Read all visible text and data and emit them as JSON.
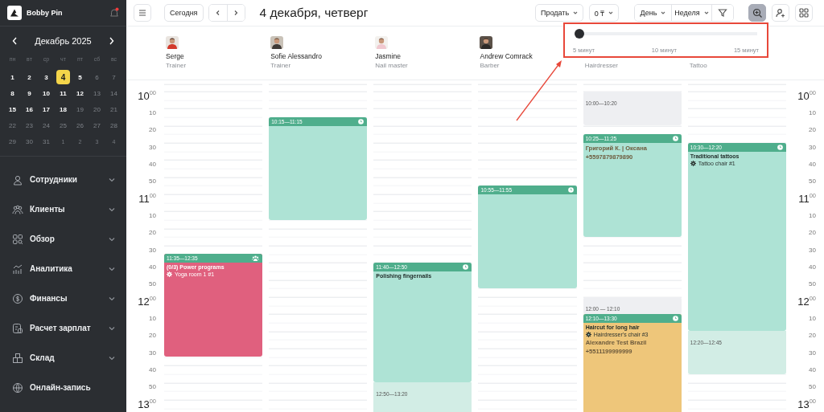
{
  "sidebar": {
    "brand": "Bobby Pin",
    "notification": true,
    "calendar": {
      "month": "Декабрь 2025",
      "weekdays": [
        "пн",
        "вт",
        "ср",
        "чт",
        "пт",
        "сб",
        "вс"
      ],
      "days": [
        {
          "label": "1",
          "kind": "active",
          "selected": false
        },
        {
          "label": "2",
          "kind": "active",
          "selected": false
        },
        {
          "label": "3",
          "kind": "active",
          "selected": false
        },
        {
          "label": "4",
          "kind": "active",
          "selected": true
        },
        {
          "label": "5",
          "kind": "active",
          "selected": false
        },
        {
          "label": "6",
          "kind": "muted",
          "selected": false
        },
        {
          "label": "7",
          "kind": "muted",
          "selected": false
        },
        {
          "label": "8",
          "kind": "active",
          "selected": false
        },
        {
          "label": "9",
          "kind": "active",
          "selected": false
        },
        {
          "label": "10",
          "kind": "active",
          "selected": false
        },
        {
          "label": "11",
          "kind": "active",
          "selected": false
        },
        {
          "label": "12",
          "kind": "active",
          "selected": false
        },
        {
          "label": "13",
          "kind": "muted",
          "selected": false
        },
        {
          "label": "14",
          "kind": "muted",
          "selected": false
        },
        {
          "label": "15",
          "kind": "active",
          "selected": false
        },
        {
          "label": "16",
          "kind": "active",
          "selected": false
        },
        {
          "label": "17",
          "kind": "active",
          "selected": false
        },
        {
          "label": "18",
          "kind": "active",
          "selected": false
        },
        {
          "label": "19",
          "kind": "muted",
          "selected": false
        },
        {
          "label": "20",
          "kind": "muted",
          "selected": false
        },
        {
          "label": "21",
          "kind": "muted",
          "selected": false
        },
        {
          "label": "22",
          "kind": "muted",
          "selected": false
        },
        {
          "label": "23",
          "kind": "muted",
          "selected": false
        },
        {
          "label": "24",
          "kind": "muted",
          "selected": false
        },
        {
          "label": "25",
          "kind": "muted",
          "selected": false
        },
        {
          "label": "26",
          "kind": "muted",
          "selected": false
        },
        {
          "label": "27",
          "kind": "muted",
          "selected": false
        },
        {
          "label": "28",
          "kind": "muted",
          "selected": false
        },
        {
          "label": "29",
          "kind": "muted",
          "selected": false
        },
        {
          "label": "30",
          "kind": "muted",
          "selected": false
        },
        {
          "label": "31",
          "kind": "muted",
          "selected": false
        },
        {
          "label": "1",
          "kind": "outside",
          "selected": false
        },
        {
          "label": "2",
          "kind": "outside",
          "selected": false
        },
        {
          "label": "3",
          "kind": "outside",
          "selected": false
        },
        {
          "label": "4",
          "kind": "outside",
          "selected": false
        }
      ]
    },
    "items": [
      {
        "label": "Сотрудники",
        "expandable": true
      },
      {
        "label": "Клиенты",
        "expandable": true
      },
      {
        "label": "Обзор",
        "expandable": true
      },
      {
        "label": "Аналитика",
        "expandable": true
      },
      {
        "label": "Финансы",
        "expandable": true
      },
      {
        "label": "Расчет зарплат",
        "expandable": true
      },
      {
        "label": "Склад",
        "expandable": true
      },
      {
        "label": "Онлайн-запись",
        "expandable": false
      }
    ]
  },
  "toolbar": {
    "today": "Сегодня",
    "title": "4 декабря, четверг",
    "sell_menu": "Продать",
    "currency_menu": "0 ₸",
    "view_menus": [
      "День",
      "Неделя"
    ],
    "tool_buttons": [
      {
        "selected": true
      },
      {
        "selected": false
      },
      {
        "selected": false
      }
    ]
  },
  "zoom_popover": {
    "level": 0,
    "labels": [
      "5 минут",
      "10 минут",
      "15 минут"
    ]
  },
  "staff": [
    {
      "name": "Serge",
      "role": "Trainer",
      "photo": {
        "kind": "picture"
      },
      "events": [
        {
          "kind": "appointment",
          "time": "11:35—12:35",
          "color": "#e0607e",
          "group": true,
          "title": "(0/3) Power programs",
          "resource": "Yoga room 1 #1"
        }
      ]
    },
    {
      "name": "Sofie Alessandro",
      "role": "Trainer",
      "photo": {
        "kind": "picture"
      },
      "events": [
        {
          "kind": "appointment",
          "time": "10:15—11:15",
          "color": "#aee3d5",
          "group": false
        }
      ]
    },
    {
      "name": "Jasmine",
      "role": "Nail master",
      "photo": {
        "kind": "picture"
      },
      "events": [
        {
          "kind": "appointment",
          "time": "11:40—12:50",
          "color": "#aee3d5",
          "group": false,
          "title": "Polishing fingernails"
        },
        {
          "kind": "extra",
          "time": "12:50—13:20"
        }
      ]
    },
    {
      "name": "Andrew Comrack",
      "role": "Barber",
      "photo": {
        "kind": "picture"
      },
      "events": [
        {
          "kind": "appointment",
          "time": "10:55—11:55",
          "color": "#aee3d5",
          "group": false
        }
      ]
    },
    {
      "role": "Hairdresser",
      "events": [
        {
          "kind": "blocked",
          "time": "10:00—10:20"
        },
        {
          "kind": "appointment",
          "time": "10:25—11:25",
          "color": "#aee3d5",
          "group": false,
          "client": "Григорий К. | Оксана",
          "phone": "+5597879879890"
        },
        {
          "kind": "blocked",
          "time": "12:00 — 12:10"
        },
        {
          "kind": "appointment",
          "time": "12:10—13:30",
          "color": "#eec67a",
          "group": false,
          "title": "Haircut for long hair",
          "resource": "Hairdresser's chair #3",
          "client": "Alexandre Test Brazil",
          "phone": "+5511199999999"
        }
      ]
    },
    {
      "role": "Tattoo",
      "events": [
        {
          "kind": "appointment",
          "time": "10:30—12:20",
          "color": "#aee3d5",
          "group": false,
          "title": "Traditional tattoos",
          "resource": "Tattoo chair #1"
        },
        {
          "kind": "extra",
          "time": "12:20—12:45"
        }
      ]
    }
  ],
  "time_axis_left": [
    {
      "kind": "hour",
      "label": "10",
      "minutes": "00"
    },
    {
      "kind": "minute",
      "label": "10"
    },
    {
      "kind": "minute",
      "label": "20"
    },
    {
      "kind": "minute",
      "label": "30"
    },
    {
      "kind": "minute",
      "label": "40"
    },
    {
      "kind": "minute",
      "label": "50"
    },
    {
      "kind": "hour",
      "label": "11",
      "minutes": "00"
    },
    {
      "kind": "minute",
      "label": "10"
    },
    {
      "kind": "minute",
      "label": "20"
    },
    {
      "kind": "minute",
      "label": "30"
    },
    {
      "kind": "minute",
      "label": "40"
    },
    {
      "kind": "minute",
      "label": "50"
    },
    {
      "kind": "hour",
      "label": "12",
      "minutes": "00"
    },
    {
      "kind": "minute",
      "label": "10"
    },
    {
      "kind": "minute",
      "label": "20"
    },
    {
      "kind": "minute",
      "label": "30"
    },
    {
      "kind": "minute",
      "label": "40"
    },
    {
      "kind": "minute",
      "label": "50"
    },
    {
      "kind": "hour",
      "label": "13",
      "minutes": "00"
    }
  ],
  "time_axis_right": [
    {
      "kind": "hour",
      "label": "10",
      "minutes": "00"
    },
    {
      "kind": "minute",
      "label": "10"
    },
    {
      "kind": "minute",
      "label": "20"
    },
    {
      "kind": "minute",
      "label": "30"
    },
    {
      "kind": "minute",
      "label": "40"
    },
    {
      "kind": "minute",
      "label": "50"
    },
    {
      "kind": "hour",
      "label": "11",
      "minutes": "00"
    },
    {
      "kind": "minute",
      "label": "10"
    },
    {
      "kind": "minute",
      "label": "20"
    },
    {
      "kind": "minute",
      "label": "30"
    },
    {
      "kind": "minute",
      "label": "40"
    },
    {
      "kind": "minute",
      "label": "50"
    },
    {
      "kind": "hour",
      "label": "12",
      "minutes": "00"
    },
    {
      "kind": "minute",
      "label": "10"
    },
    {
      "kind": "minute",
      "label": "20"
    },
    {
      "kind": "minute",
      "label": "30"
    },
    {
      "kind": "minute",
      "label": "40"
    },
    {
      "kind": "minute",
      "label": "50"
    },
    {
      "kind": "hour",
      "label": "13",
      "minutes": "00"
    }
  ]
}
